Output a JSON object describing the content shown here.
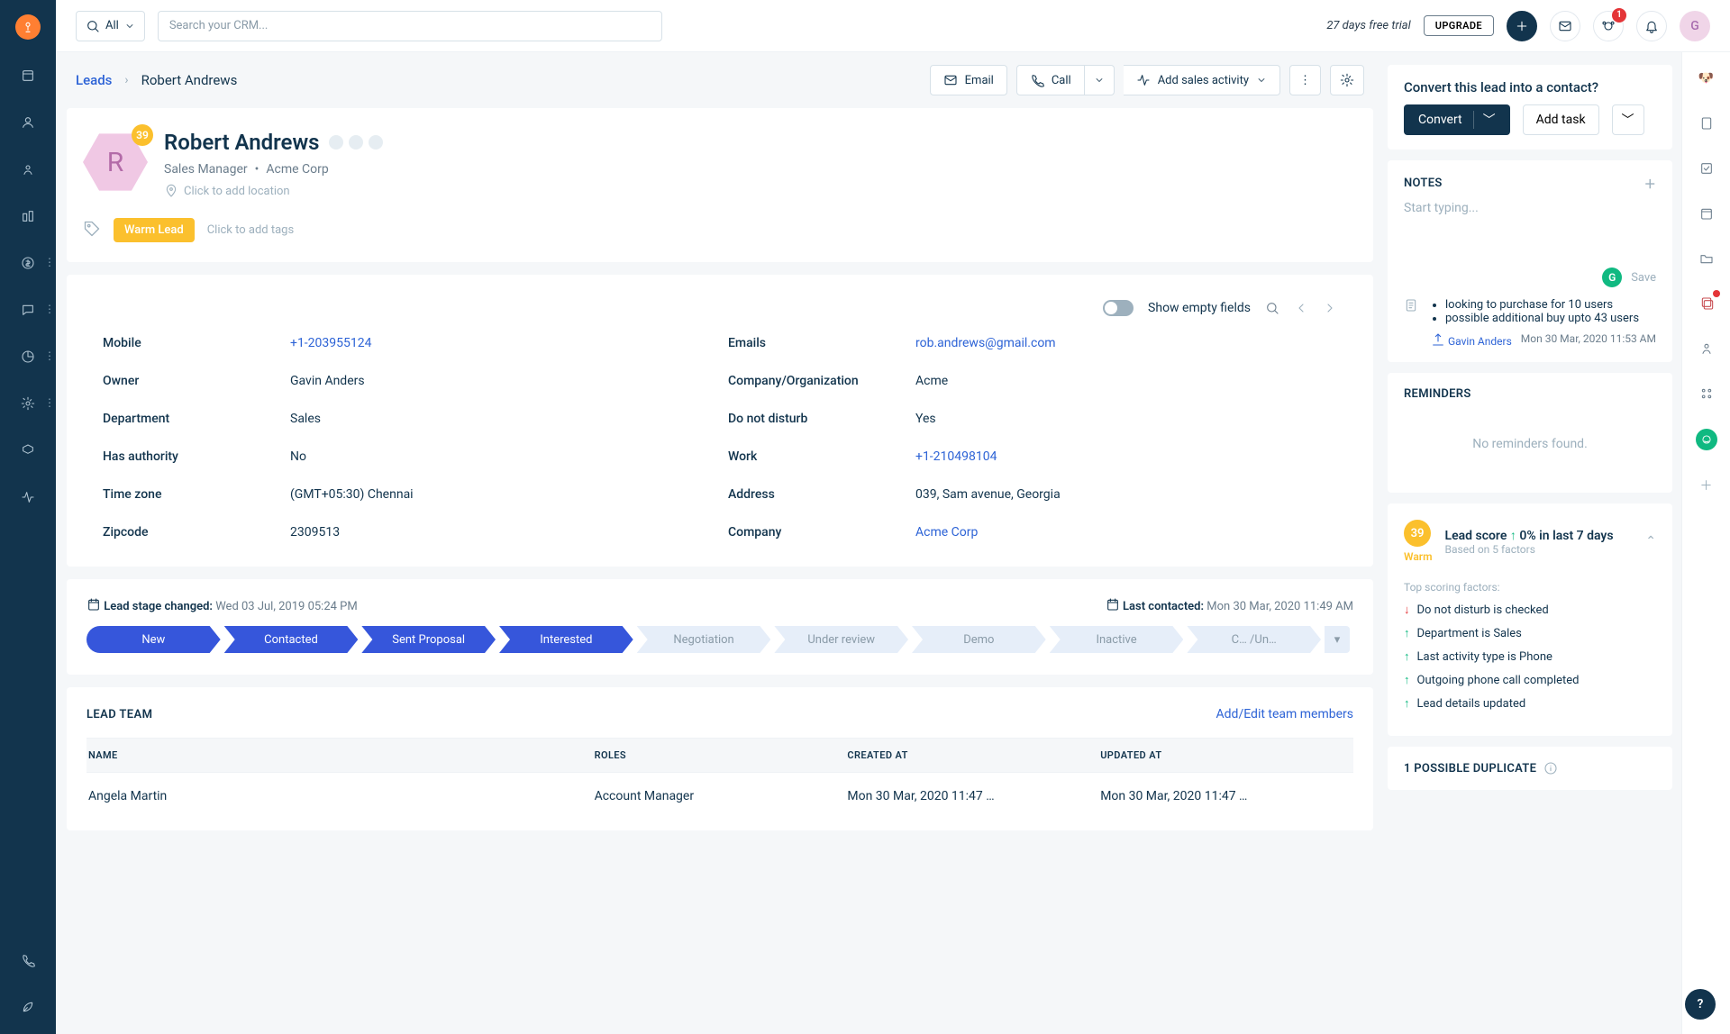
{
  "topbar": {
    "filter_label": "All",
    "search_placeholder": "Search your CRM...",
    "trial_text": "27 days free trial",
    "upgrade_label": "UPGRADE",
    "notif_count": "1",
    "avatar_initial": "G"
  },
  "breadcrumb": {
    "root": "Leads",
    "current": "Robert Andrews",
    "email_btn": "Email",
    "call_btn": "Call",
    "activity_btn": "Add sales activity"
  },
  "lead": {
    "score": "39",
    "initial": "R",
    "name": "Robert Andrews",
    "title": "Sales Manager",
    "company_short": "Acme Corp",
    "location_placeholder": "Click to add location",
    "tag": "Warm Lead",
    "add_tags_placeholder": "Click to add tags"
  },
  "details_toolbar": {
    "toggle_label": "Show empty fields"
  },
  "details": {
    "left": [
      {
        "label": "Mobile",
        "value": "+1-203955124",
        "link": true
      },
      {
        "label": "Owner",
        "value": "Gavin Anders",
        "link": false
      },
      {
        "label": "Department",
        "value": "Sales",
        "link": false
      },
      {
        "label": "Has authority",
        "value": "No",
        "link": false
      },
      {
        "label": "Time zone",
        "value": "(GMT+05:30) Chennai",
        "link": false
      },
      {
        "label": "Zipcode",
        "value": "2309513",
        "link": false
      }
    ],
    "right": [
      {
        "label": "Emails",
        "value": "rob.andrews@gmail.com",
        "link": true
      },
      {
        "label": "Company/Organization",
        "value": "Acme",
        "link": false
      },
      {
        "label": "Do not disturb",
        "value": "Yes",
        "link": false
      },
      {
        "label": "Work",
        "value": "+1-210498104",
        "link": true
      },
      {
        "label": "Address",
        "value": "039, Sam avenue, Georgia",
        "link": false
      },
      {
        "label": "Company",
        "value": "Acme Corp",
        "link": true
      }
    ]
  },
  "stage": {
    "changed_label": "Lead stage changed:",
    "changed_value": "Wed 03 Jul, 2019 05:24 PM",
    "contacted_label": "Last contacted:",
    "contacted_value": "Mon 30 Mar, 2020 11:49 AM",
    "stages": [
      {
        "name": "New",
        "active": true
      },
      {
        "name": "Contacted",
        "active": true
      },
      {
        "name": "Sent Proposal",
        "active": true
      },
      {
        "name": "Interested",
        "active": true
      },
      {
        "name": "Negotiation",
        "active": false
      },
      {
        "name": "Under review",
        "active": false
      },
      {
        "name": "Demo",
        "active": false
      },
      {
        "name": "Inactive",
        "active": false
      },
      {
        "name": "C… /Un…",
        "active": false
      }
    ]
  },
  "team": {
    "title": "LEAD TEAM",
    "edit_link": "Add/Edit team members",
    "columns": [
      "NAME",
      "ROLES",
      "CREATED AT",
      "UPDATED AT"
    ],
    "rows": [
      {
        "name": "Angela Martin",
        "role": "Account Manager",
        "created": "Mon 30 Mar, 2020 11:47 …",
        "updated": "Mon 30 Mar, 2020 11:47 …"
      }
    ]
  },
  "right": {
    "convert_prompt": "Convert this lead into a contact?",
    "convert_btn": "Convert",
    "add_task_btn": "Add task",
    "notes_title": "NOTES",
    "notes_placeholder": "Start typing...",
    "save_label": "Save",
    "note_items": [
      "looking to purchase for 10 users",
      "possible additional buy upto 43 users"
    ],
    "note_author": "Gavin Anders",
    "note_time": "Mon 30 Mar, 2020 11:53 AM",
    "reminders_title": "REMINDERS",
    "reminders_empty": "No reminders found.",
    "score_circle": "39",
    "score_warm": "Warm",
    "score_title": "Lead score",
    "score_change": "0%",
    "score_period": "in last 7 days",
    "score_sub": "Based on 5 factors",
    "factors_title": "Top scoring factors:",
    "factors": [
      {
        "dir": "down",
        "text": "Do not disturb is checked"
      },
      {
        "dir": "up",
        "text": "Department is Sales"
      },
      {
        "dir": "up",
        "text": "Last activity type is Phone"
      },
      {
        "dir": "up",
        "text": "Outgoing phone call completed"
      },
      {
        "dir": "up",
        "text": "Lead details updated"
      }
    ],
    "duplicate": "1 POSSIBLE DUPLICATE"
  }
}
